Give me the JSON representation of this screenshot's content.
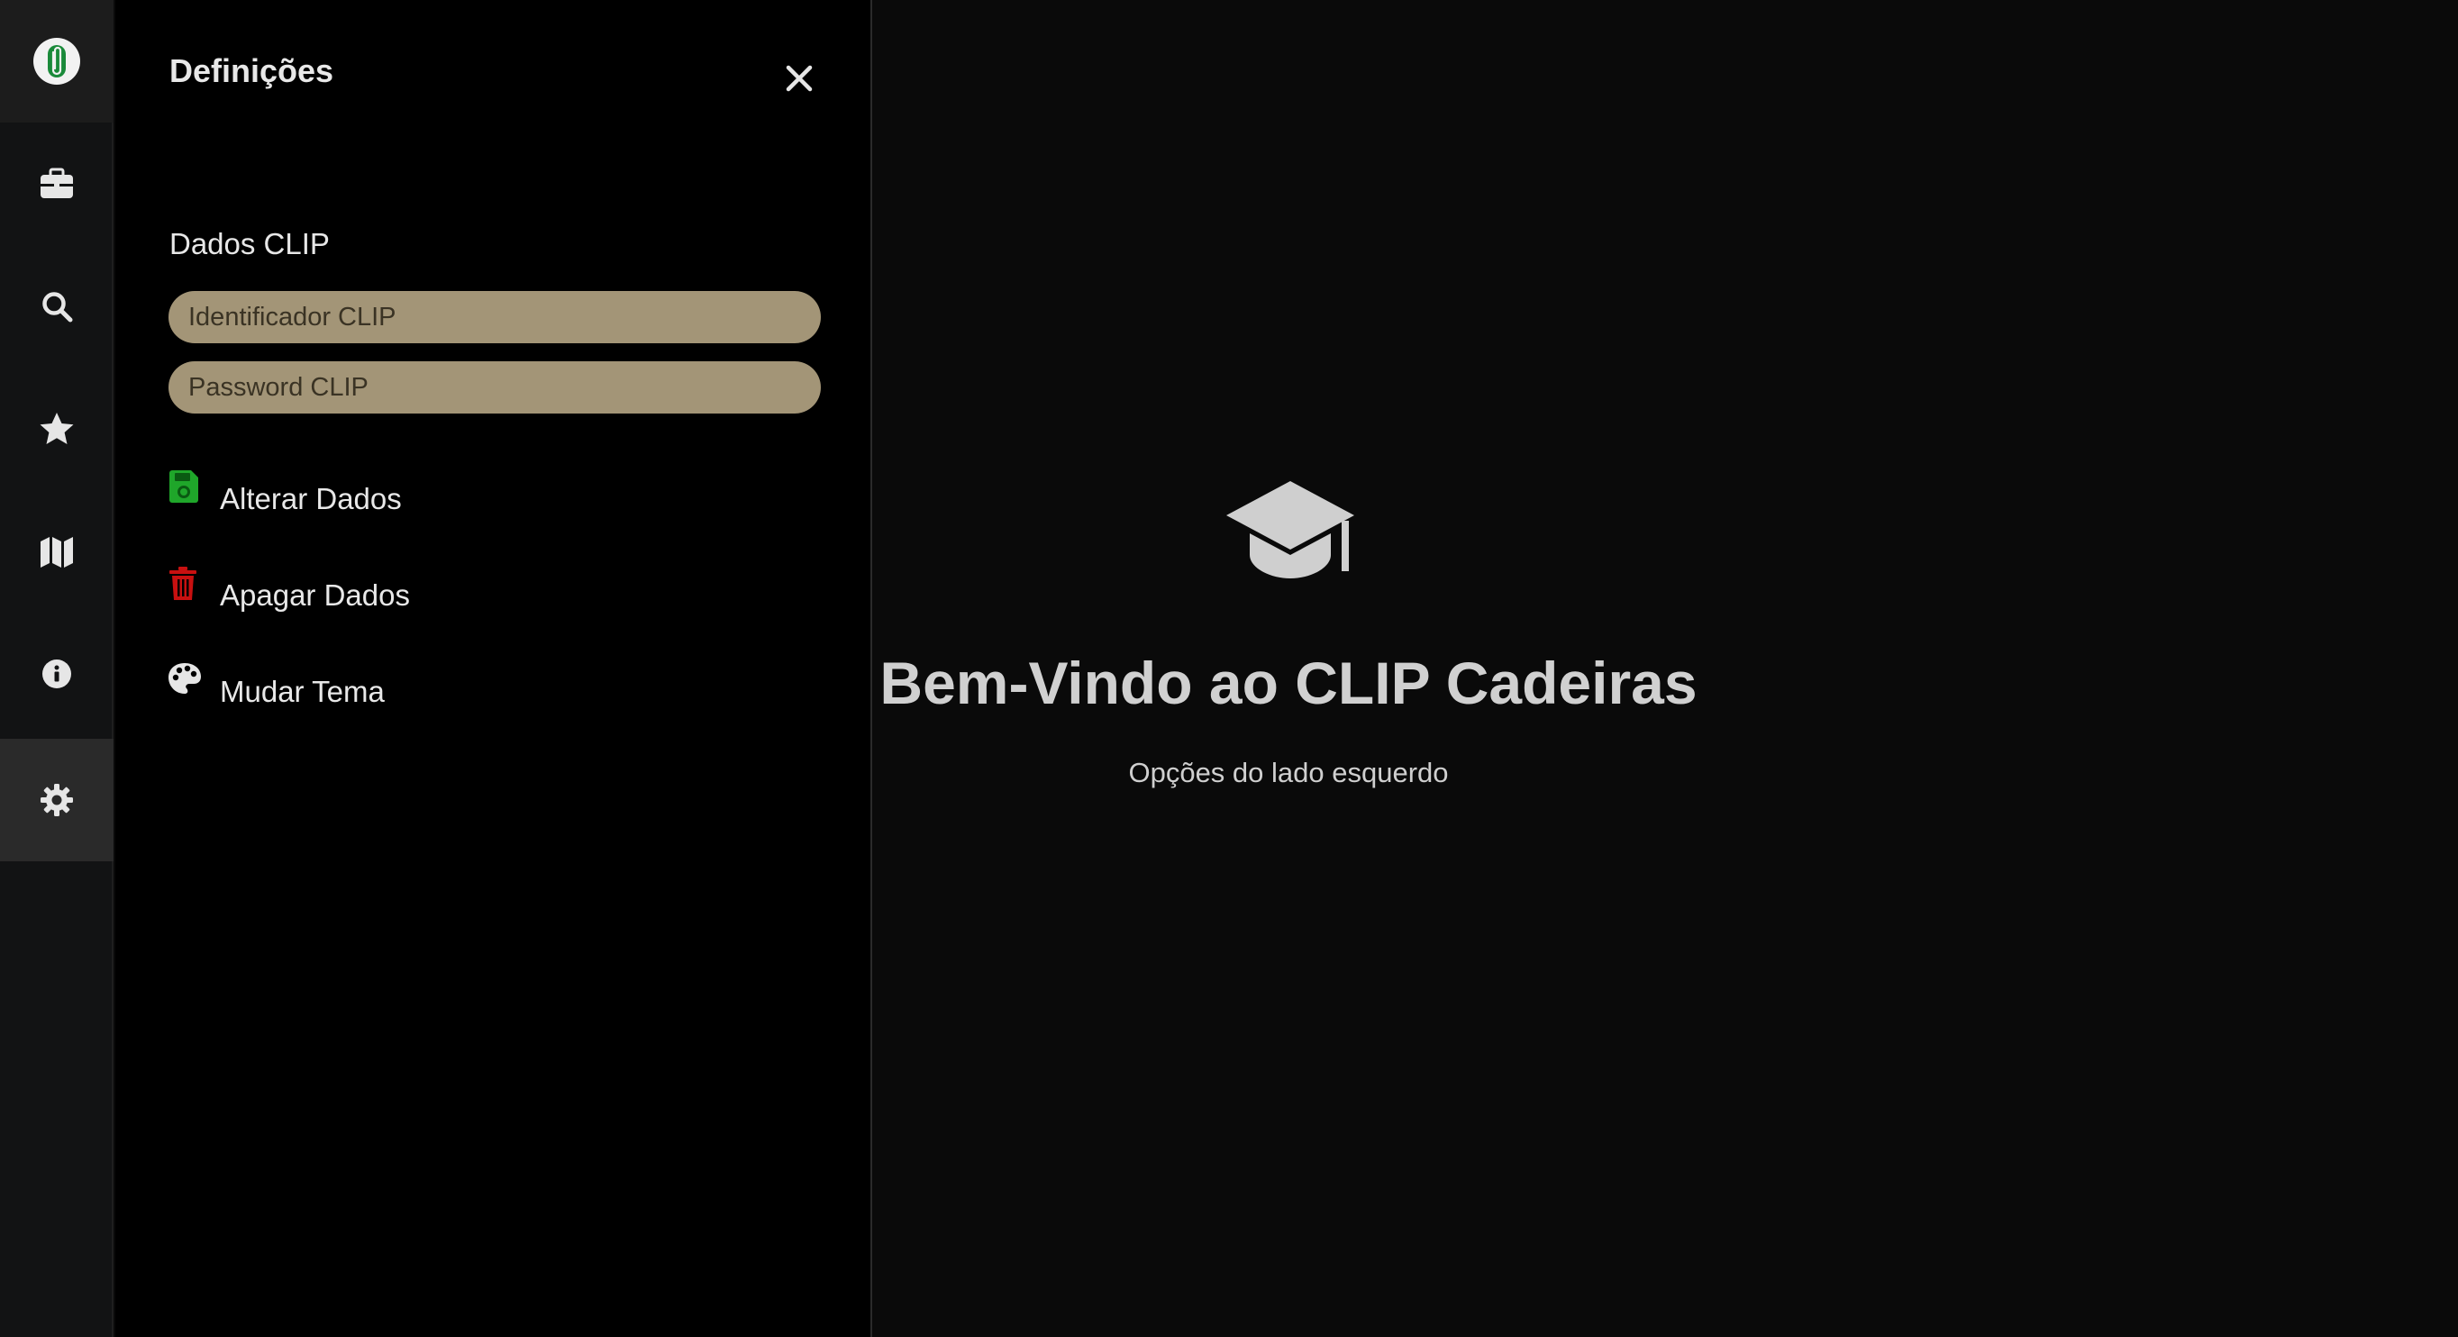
{
  "sidebar": {
    "items": [
      {
        "icon": "logo-icon"
      },
      {
        "icon": "briefcase-icon"
      },
      {
        "icon": "search-icon"
      },
      {
        "icon": "star-icon"
      },
      {
        "icon": "map-icon"
      },
      {
        "icon": "info-icon"
      },
      {
        "icon": "gear-icon",
        "active": true
      }
    ]
  },
  "settings": {
    "title": "Definições",
    "close_icon": "close-icon",
    "section_label": "Dados CLIP",
    "id_placeholder": "Identificador CLIP",
    "password_placeholder": "Password CLIP",
    "actions": {
      "save": {
        "label": "Alterar Dados",
        "icon": "save-icon",
        "color": "#1fa62a"
      },
      "delete": {
        "label": "Apagar Dados",
        "icon": "trash-icon",
        "color": "#c81010"
      },
      "theme": {
        "label": "Mudar Tema",
        "icon": "palette-icon",
        "color": "#e6e6e6"
      }
    }
  },
  "main": {
    "icon": "graduation-cap-icon",
    "title": "Bem-Vindo ao CLIP Cadeiras",
    "subtitle": "Opções do lado esquerdo"
  },
  "colors": {
    "field_bg": "#a39577",
    "rail_bg": "#121314",
    "panel_bg": "#000000",
    "main_bg": "#0a0a0a",
    "logo_green": "#1a8a3a"
  }
}
